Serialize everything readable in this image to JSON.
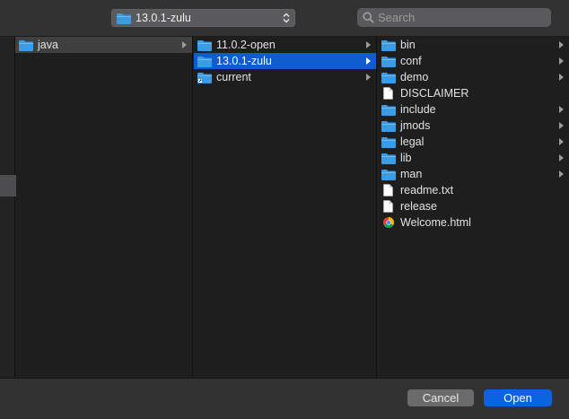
{
  "topbar": {
    "path_label": "13.0.1-zulu",
    "search_placeholder": "Search"
  },
  "columns": {
    "col1": [
      {
        "name": "java",
        "type": "folder",
        "chevron": true,
        "state": "inactive-selected"
      }
    ],
    "col2": [
      {
        "name": "11.0.2-open",
        "type": "folder",
        "chevron": true,
        "state": "none"
      },
      {
        "name": "13.0.1-zulu",
        "type": "folder",
        "chevron": true,
        "state": "selected"
      },
      {
        "name": "current",
        "type": "folder-alias",
        "chevron": true,
        "state": "none"
      }
    ],
    "col3": [
      {
        "name": "bin",
        "type": "folder",
        "chevron": true
      },
      {
        "name": "conf",
        "type": "folder",
        "chevron": true
      },
      {
        "name": "demo",
        "type": "folder",
        "chevron": true
      },
      {
        "name": "DISCLAIMER",
        "type": "document",
        "chevron": false
      },
      {
        "name": "include",
        "type": "folder",
        "chevron": true
      },
      {
        "name": "jmods",
        "type": "folder",
        "chevron": true
      },
      {
        "name": "legal",
        "type": "folder",
        "chevron": true
      },
      {
        "name": "lib",
        "type": "folder",
        "chevron": true
      },
      {
        "name": "man",
        "type": "folder",
        "chevron": true
      },
      {
        "name": "readme.txt",
        "type": "document",
        "chevron": false
      },
      {
        "name": "release",
        "type": "document",
        "chevron": false
      },
      {
        "name": "Welcome.html",
        "type": "html-chrome",
        "chevron": false
      }
    ]
  },
  "footer": {
    "cancel_label": "Cancel",
    "open_label": "Open"
  },
  "colors": {
    "accent": "#0f5cd1",
    "folder": "#3b9be3",
    "background": "#1e1e1e"
  }
}
